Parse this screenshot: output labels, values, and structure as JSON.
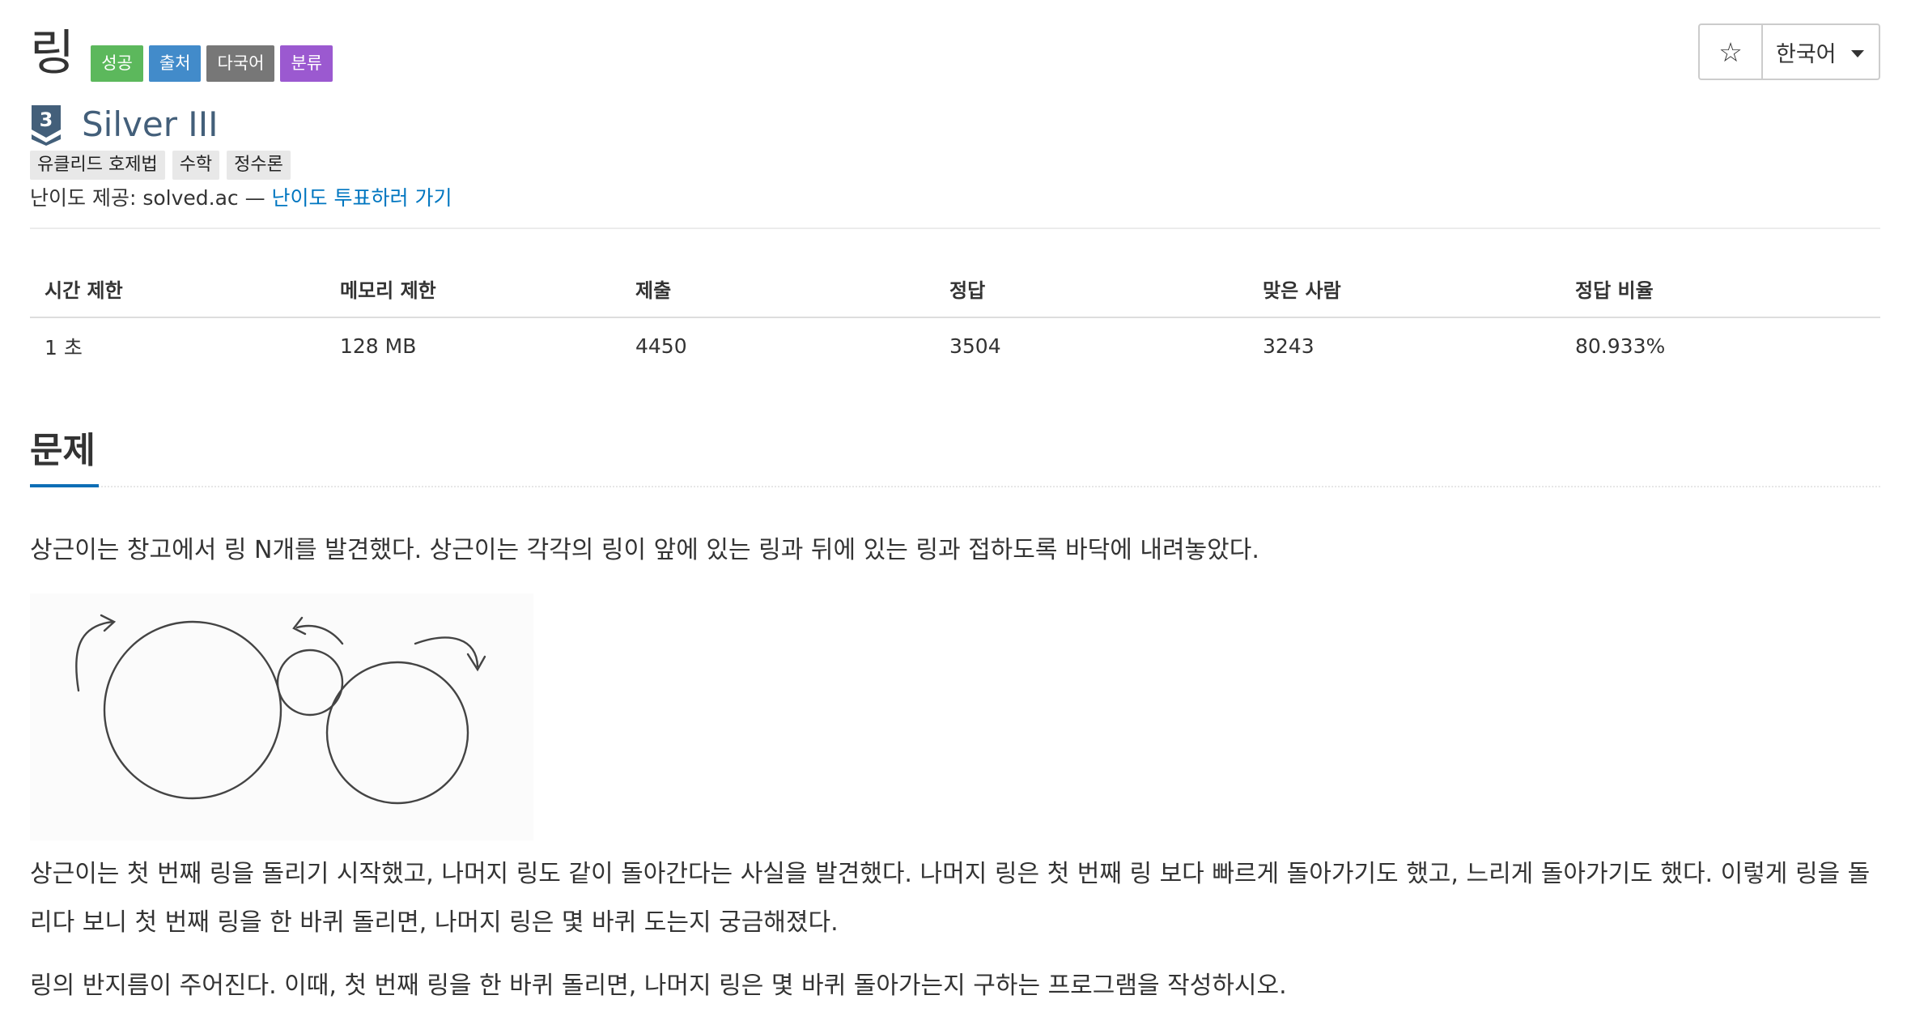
{
  "problem": {
    "title": "링",
    "labels": [
      {
        "text": "성공",
        "color": "#5cb85c"
      },
      {
        "text": "출처",
        "color": "#428bca"
      },
      {
        "text": "다국어",
        "color": "#777777"
      },
      {
        "text": "분류",
        "color": "#9b59d0"
      }
    ]
  },
  "toolbar": {
    "star_icon": "☆",
    "language": "한국어"
  },
  "tier": {
    "number": "3",
    "name": "Silver III",
    "color": "#435f7a"
  },
  "algorithm_tags": [
    "유클리드 호제법",
    "수학",
    "정수론"
  ],
  "provider": {
    "prefix": "난이도 제공: solved.ac — ",
    "link": "난이도 투표하러 가기"
  },
  "info_table": {
    "headers": [
      "시간 제한",
      "메모리 제한",
      "제출",
      "정답",
      "맞은 사람",
      "정답 비율"
    ],
    "values": [
      "1 초",
      "128 MB",
      "4450",
      "3504",
      "3243",
      "80.933%"
    ]
  },
  "section": {
    "title": "문제"
  },
  "statement": {
    "p1": "상근이는 창고에서 링 N개를 발견했다. 상근이는 각각의 링이 앞에 있는 링과 뒤에 있는 링과 접하도록 바닥에 내려놓았다.",
    "p2": "상근이는 첫 번째 링을 돌리기 시작했고, 나머지 링도 같이 돌아간다는 사실을 발견했다. 나머지 링은 첫 번째 링 보다 빠르게 돌아가기도 했고, 느리게 돌아가기도 했다. 이렇게 링을 돌리다 보니 첫 번째 링을 한 바퀴 돌리면, 나머지 링은 몇 바퀴 도는지 궁금해졌다.",
    "p3": "링의 반지름이 주어진다. 이때, 첫 번째 링을 한 바퀴 돌리면, 나머지 링은 몇 바퀴 돌아가는지 구하는 프로그램을 작성하시오."
  }
}
